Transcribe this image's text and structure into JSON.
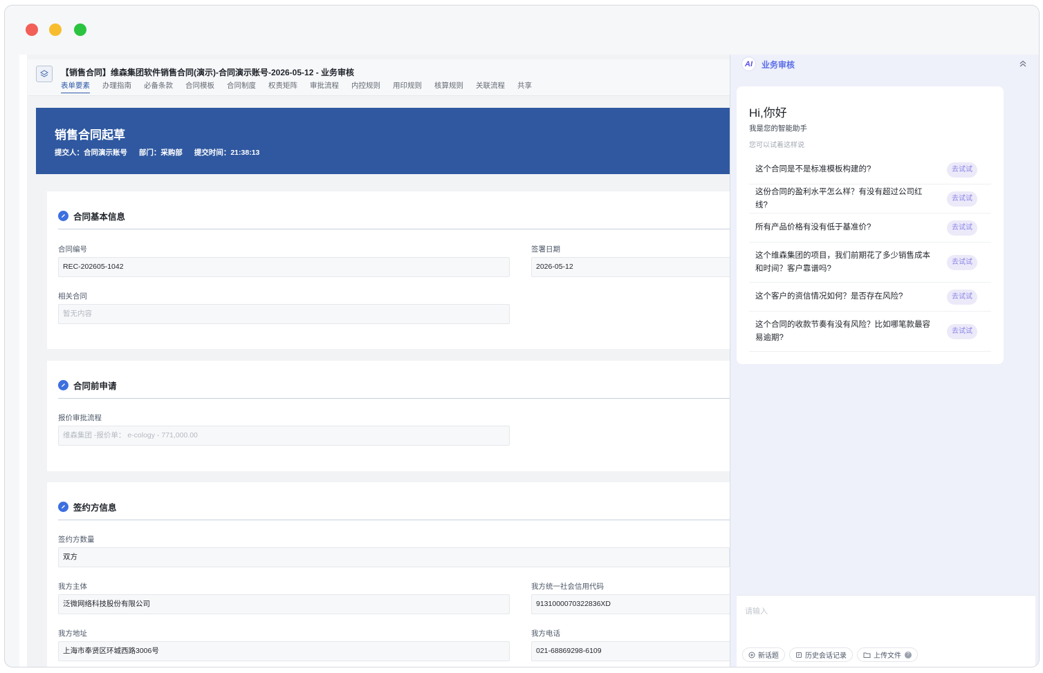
{
  "doc": {
    "title": "【销售合同】维森集团软件销售合同(演示)-合同演示账号-2026-05-12 - 业务审核",
    "tabs": [
      "表单要素",
      "办理指南",
      "必备条款",
      "合同模板",
      "合同制度",
      "权责矩阵",
      "审批流程",
      "内控规则",
      "用印规则",
      "核算规则",
      "关联流程",
      "共享"
    ],
    "active_tab": "表单要素"
  },
  "banner": {
    "title": "销售合同起草",
    "submitter": "提交人：合同演示账号",
    "department": "部门：采购部",
    "submit_time": "提交时间：21:38:13"
  },
  "sections": {
    "basic": {
      "title": "合同基本信息",
      "contract_no_label": "合同编号",
      "contract_no_value": "REC-202605-1042",
      "sign_date_label": "签署日期",
      "sign_date_value": "2026-05-12",
      "related_label": "相关合同",
      "related_placeholder": "暂无内容"
    },
    "pre": {
      "title": "合同前申请",
      "quote_label": "报价审批流程",
      "quote_value": "维森集团 -报价单：  e-cology - 771,000.00"
    },
    "party": {
      "title": "签约方信息",
      "count_label": "签约方数量",
      "count_value": "双方",
      "our_entity_label": "我方主体",
      "our_entity_value": "泛微网络科技股份有限公司",
      "credit_code_label": "我方统一社会信用代码",
      "credit_code_value": "9131000070322836XD",
      "address_label": "我方地址",
      "address_value": "上海市奉贤区环城西路3006号",
      "phone_label": "我方电话",
      "phone_value": "021-68869298-6109"
    }
  },
  "assistant": {
    "title": "业务审核",
    "logo_text": "AI",
    "greeting": "Hi,你好",
    "intro": "我是您的智能助手",
    "hint": "您可以试着这样说",
    "try_label": "去试试",
    "questions": [
      "这个合同是不是标准模板构建的?",
      "这份合同的盈利水平怎么样？有没有超过公司红线?",
      "所有产品价格有没有低于基准价?",
      "这个维森集团的项目，我们前期花了多少销售成本和时间？客户靠谱吗?",
      "这个客户的资信情况如何？是否存在风险?",
      "这个合同的收款节奏有没有风险？比如哪笔款最容易逾期?"
    ],
    "input_placeholder": "请输入",
    "tools": {
      "new_topic": "新话题",
      "history": "历史会话记录",
      "upload": "上传文件"
    }
  },
  "colors": {
    "banner": "#2f58a0",
    "accent": "#3d6fe0",
    "assistant_accent": "#5b6ee8"
  }
}
